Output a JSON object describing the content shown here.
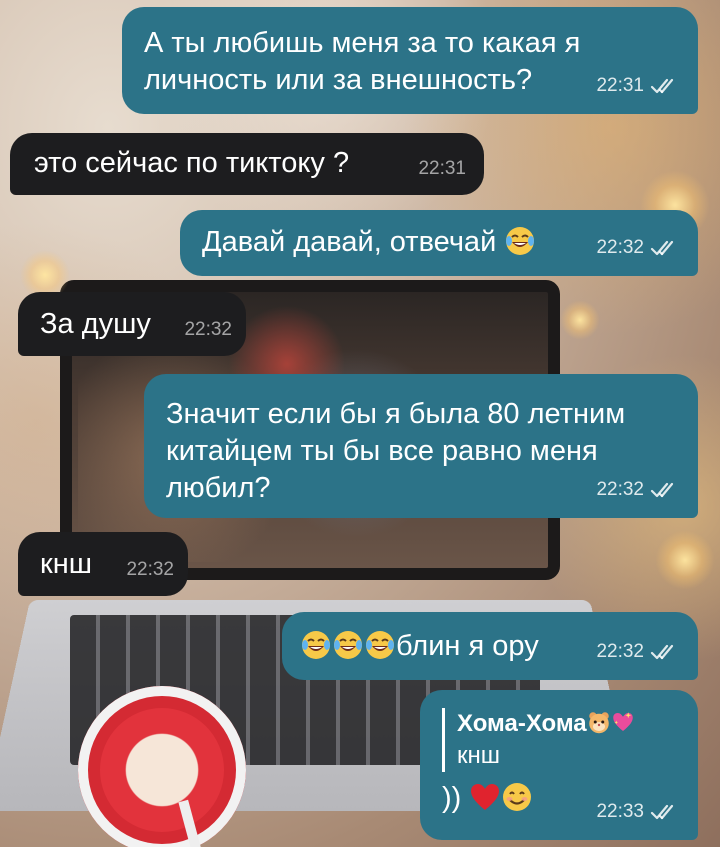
{
  "messages": [
    {
      "id": "m1",
      "direction": "outgoing",
      "text": "А ты любишь меня за то какая я\nличность или за внешность?",
      "time": "22:31",
      "read": true
    },
    {
      "id": "m2",
      "direction": "incoming",
      "text": "это сейчас по тиктоку ?",
      "time": "22:31"
    },
    {
      "id": "m3",
      "direction": "outgoing",
      "text": "Давай давай, отвечай",
      "emoji_after": [
        "face-with-tears-of-joy"
      ],
      "time": "22:32",
      "read": true
    },
    {
      "id": "m4",
      "direction": "incoming",
      "text": "За душу",
      "time": "22:32"
    },
    {
      "id": "m5",
      "direction": "outgoing",
      "text": "Значит если бы я была 80 летним\nкитайцем ты бы все равно меня\nлюбил?",
      "time": "22:32",
      "read": true
    },
    {
      "id": "m6",
      "direction": "incoming",
      "text": "кнш",
      "time": "22:32"
    },
    {
      "id": "m7",
      "direction": "outgoing",
      "emoji_before": [
        "face-with-tears-of-joy",
        "face-with-tears-of-joy",
        "face-with-tears-of-joy"
      ],
      "text": "блин я ору",
      "time": "22:32",
      "read": true
    },
    {
      "id": "m8",
      "direction": "outgoing",
      "reply_to": {
        "author": "Хома-Хома",
        "author_emojis": [
          "hamster-face",
          "sparkling-heart"
        ],
        "text": "кнш"
      },
      "text": "))",
      "emoji_after": [
        "red-heart",
        "smiling-face"
      ],
      "time": "22:33",
      "read": true
    }
  ],
  "colors": {
    "outgoing_bubble": "#2c7388",
    "incoming_bubble": "#1d1d1f",
    "text": "#ffffff"
  },
  "icons": [
    "double-check-icon",
    "face-with-tears-of-joy",
    "hamster-face",
    "sparkling-heart",
    "red-heart",
    "smiling-face"
  ]
}
